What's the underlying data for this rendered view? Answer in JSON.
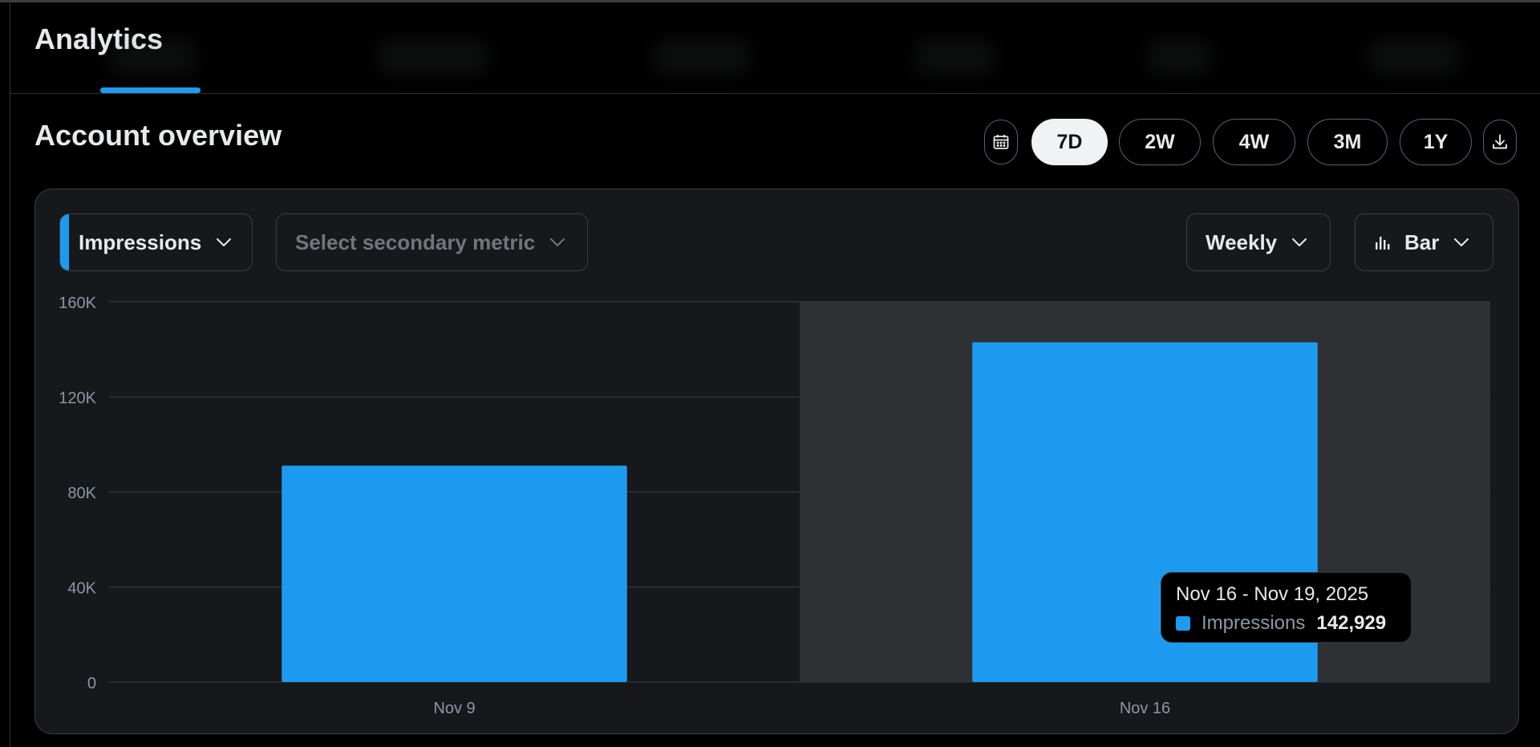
{
  "header": {
    "title": "Analytics"
  },
  "overview": {
    "title": "Account overview"
  },
  "range": {
    "options": [
      {
        "label": "7D",
        "active": true
      },
      {
        "label": "2W",
        "active": false
      },
      {
        "label": "4W",
        "active": false
      },
      {
        "label": "3M",
        "active": false
      },
      {
        "label": "1Y",
        "active": false
      }
    ]
  },
  "controls": {
    "primary_metric": "Impressions",
    "secondary_metric_placeholder": "Select secondary metric",
    "interval": "Weekly",
    "chart_type": "Bar"
  },
  "tooltip": {
    "range": "Nov 16 - Nov 19, 2025",
    "series": "Impressions",
    "value": "142,929"
  },
  "colors": {
    "accent": "#1d9bf0",
    "background": "#000000",
    "card": "#16181c",
    "highlight": "#2f3033"
  },
  "icons": {
    "calendar": "calendar-icon",
    "download": "download-icon",
    "chevron": "chevron-down-icon",
    "bar_chart": "bar-chart-icon"
  },
  "chart_data": {
    "type": "bar",
    "categories": [
      "Nov 9",
      "Nov 16"
    ],
    "series": [
      {
        "name": "Impressions",
        "values": [
          91000,
          142929
        ]
      }
    ],
    "ylim": [
      0,
      160000
    ],
    "yticks": [
      {
        "value": 0,
        "label": "0"
      },
      {
        "value": 40000,
        "label": "40K"
      },
      {
        "value": 80000,
        "label": "80K"
      },
      {
        "value": 120000,
        "label": "120K"
      },
      {
        "value": 160000,
        "label": "160K"
      }
    ],
    "highlighted_category": "Nov 16",
    "grid": true,
    "legend": "none"
  }
}
